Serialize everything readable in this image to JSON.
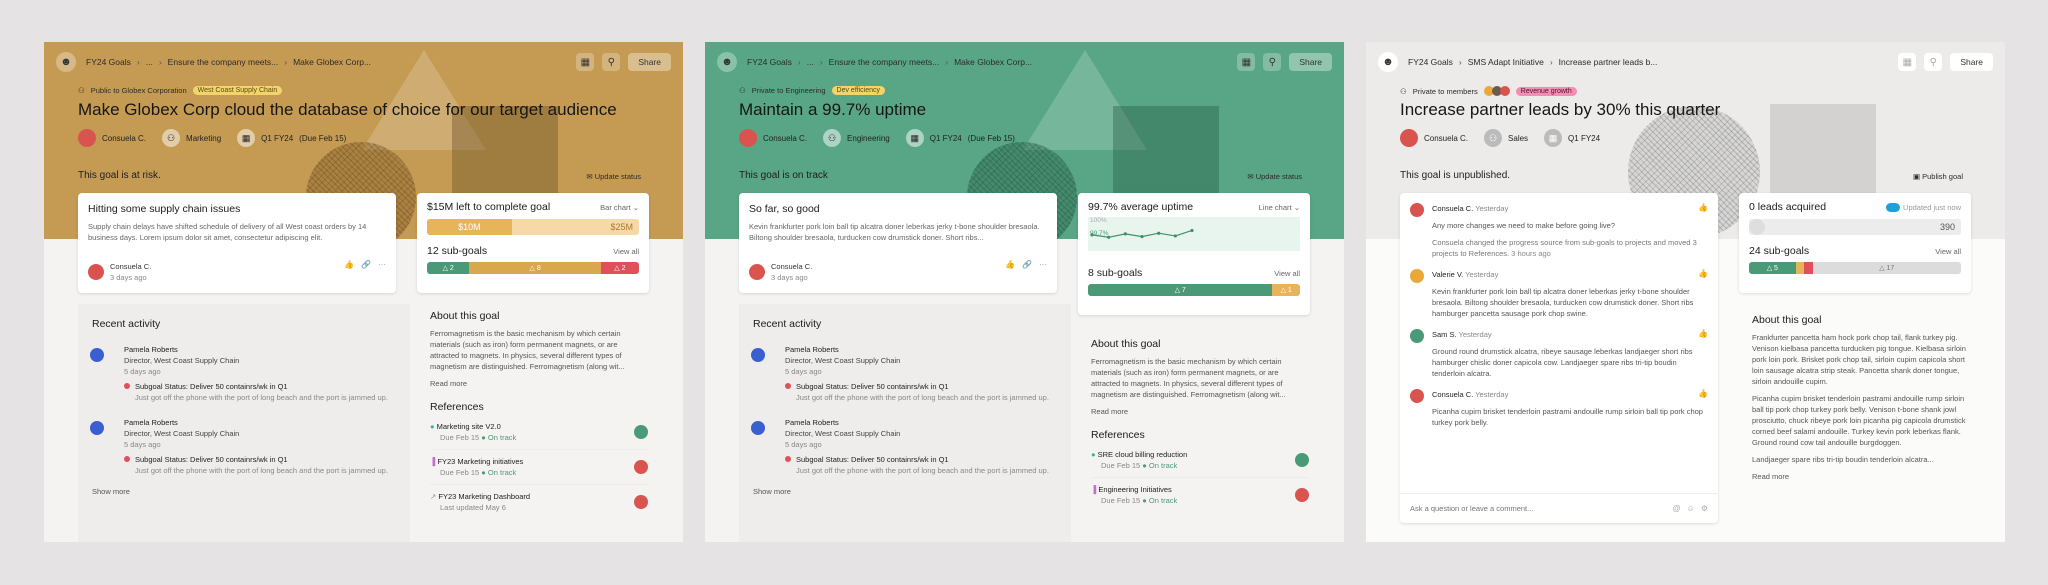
{
  "screens": [
    {
      "theme": {
        "band": "#c59b54",
        "accent": "#c59b54"
      },
      "breadcrumbs": [
        "FY24 Goals",
        "...",
        "Ensure the company meets...",
        "Make Globex Corp..."
      ],
      "share": "Share",
      "privacy": "Public to Globex Corporation",
      "tag": "West Coast Supply Chain",
      "title": "Make Globex Corp cloud the database of choice for our target audience",
      "owner": "Consuela C.",
      "team": "Marketing",
      "period": "Q1 FY24",
      "due": "(Due Feb 15)",
      "status": "This goal is at risk.",
      "update_status": "Update status",
      "update_card": {
        "title": "Hitting some supply chain issues",
        "body": "Supply chain delays have shifted schedule of delivery of all West coast orders by 14 business days. Lorem ipsum dolor sit amet, consectetur adipiscing elit.",
        "author": "Consuela C.",
        "time": "3 days ago"
      },
      "metric_card": {
        "title": "$15M left to complete goal",
        "chart_type": "Bar chart",
        "current": "$10M",
        "target": "$25M",
        "progress": 0.4,
        "subgoals_label": "12 sub-goals",
        "view_all": "View all",
        "seg": [
          {
            "label": "△ 2",
            "share": 0.2,
            "color": "#4a9a78"
          },
          {
            "label": "△ 8",
            "share": 0.62,
            "color": "#d8a74e"
          },
          {
            "label": "△ 2",
            "share": 0.18,
            "color": "#e0505b"
          }
        ]
      },
      "recent_activity": {
        "title": "Recent activity",
        "items": [
          {
            "name": "Pamela Roberts",
            "role": "Director, West Coast Supply Chain",
            "time": "5 days ago",
            "status": "Subgoal Status: Deliver 50 containrs/wk in Q1",
            "note": "Just got off the phone with the port of long beach and the port is jammed up."
          },
          {
            "name": "Pamela Roberts",
            "role": "Director, West Coast Supply Chain",
            "time": "5 days ago",
            "status": "Subgoal Status: Deliver 50 containrs/wk in Q1",
            "note": "Just got off the phone with the port of long beach and the port is jammed up."
          }
        ],
        "show_more": "Show more"
      },
      "about": {
        "title": "About this goal",
        "body": "Ferromagnetism is the basic mechanism by which certain materials (such as iron) form permanent magnets, or are attracted to magnets. In physics, several different types of magnetism are distinguished. Ferromagnetism (along wit...",
        "read_more": "Read more"
      },
      "references": {
        "title": "References",
        "items": [
          {
            "icon": "●",
            "icon_color": "#2bb5a5",
            "name": "Marketing site V2.0",
            "due": "Due Feb 15",
            "state": "On track",
            "av": "#4a9a78"
          },
          {
            "icon": "▐",
            "icon_color": "#c06fd0",
            "name": "FY23 Marketing initiatives",
            "due": "Due Feb 15",
            "state": "On track",
            "av": "#d9534f"
          },
          {
            "icon": "↗",
            "icon_color": "#999",
            "name": "FY23 Marketing Dashboard",
            "due": "Last updated May 6",
            "state": "",
            "av": "#d9534f"
          }
        ]
      }
    },
    {
      "theme": {
        "band": "#58a686",
        "accent": "#58a686"
      },
      "breadcrumbs": [
        "FY24 Goals",
        "...",
        "Ensure the company meets...",
        "Make Globex Corp..."
      ],
      "share": "Share",
      "privacy": "Private to Engineering",
      "tag": "Dev efficiency",
      "title": "Maintain a 99.7% uptime",
      "owner": "Consuela C.",
      "team": "Engineering",
      "period": "Q1 FY24",
      "due": "(Due Feb 15)",
      "status": "This goal is on track",
      "update_status": "Update status",
      "update_card": {
        "title": "So far, so good",
        "body": "Kevin frankfurter pork loin ball tip alcatra doner leberkas jerky t-bone shoulder bresaola. Biltong shoulder bresaola, turducken cow drumstick doner. Short ribs...",
        "author": "Consuela C.",
        "time": "3 days ago"
      },
      "metric_card": {
        "title": "99.7% average uptime",
        "chart_type": "Line chart",
        "y_top": "100%",
        "y_val": "99.7%",
        "line": [
          0.35,
          0.42,
          0.32,
          0.4,
          0.3,
          0.38,
          0.22
        ],
        "subgoals_label": "8 sub-goals",
        "view_all": "View all",
        "seg": [
          {
            "label": "△ 7",
            "share": 0.87,
            "color": "#4a9a78"
          },
          {
            "label": "△ 1",
            "share": 0.13,
            "color": "#e8b45a"
          }
        ]
      },
      "recent_activity": {
        "title": "Recent activity",
        "items": [
          {
            "name": "Pamela Roberts",
            "role": "Director, West Coast Supply Chain",
            "time": "5 days ago",
            "status": "Subgoal Status: Deliver 50 containrs/wk in Q1",
            "note": "Just got off the phone with the port of long beach and the port is jammed up."
          },
          {
            "name": "Pamela Roberts",
            "role": "Director, West Coast Supply Chain",
            "time": "5 days ago",
            "status": "Subgoal Status: Deliver 50 containrs/wk in Q1",
            "note": "Just got off the phone with the port of long beach and the port is jammed up."
          }
        ],
        "show_more": "Show more"
      },
      "about": {
        "title": "About this goal",
        "body": "Ferromagnetism is the basic mechanism by which certain materials (such as iron) form permanent magnets, or are attracted to magnets. In physics, several different types of magnetism are distinguished. Ferromagnetism (along wit...",
        "read_more": "Read more"
      },
      "references": {
        "title": "References",
        "items": [
          {
            "icon": "●",
            "icon_color": "#2bb5a5",
            "name": "SRE cloud billing reduction",
            "due": "Due Feb 15",
            "state": "On track",
            "av": "#4a9a78"
          },
          {
            "icon": "▐",
            "icon_color": "#c06fd0",
            "name": "Engineering Initiatives",
            "due": "Due Feb 15",
            "state": "On track",
            "av": "#d9534f"
          }
        ]
      }
    },
    {
      "theme": {
        "band": "#ecebea",
        "accent": "#aaaaaa"
      },
      "breadcrumbs": [
        "FY24 Goals",
        "SMS Adapt Initiative",
        "Increase partner leads b..."
      ],
      "share": "Share",
      "privacy": "Private to members",
      "tag": "Revenue growth",
      "title": "Increase partner leads by 30% this quarter",
      "owner": "Consuela C.",
      "team": "Sales",
      "period": "Q1 FY24",
      "status": "This goal is unpublished.",
      "publish": "Publish goal",
      "comments": [
        {
          "name": "Consuela C.",
          "time": "Yesterday",
          "body": "Any more changes we need to make before going live?",
          "system": "Consuela changed the progress source from sub-goals to projects and moved 3 projects to References.",
          "system_time": "3 hours ago",
          "av": "#d9534f"
        },
        {
          "name": "Valerie V.",
          "time": "Yesterday",
          "body": "Kevin frankfurter pork loin ball tip alcatra doner leberkas jerky t-bone shoulder bresaola. Biltong shoulder bresaola, turducken cow drumstick doner. Short ribs hamburger pancetta sausage pork chop swine.",
          "av": "#e8a93a"
        },
        {
          "name": "Sam S.",
          "time": "Yesterday",
          "body": "Ground round drumstick alcatra, ribeye sausage leberkas landjaeger short ribs hamburger chislic doner capicola cow. Landjaeger spare ribs tri-tip boudin tenderloin alcatra.",
          "av": "#4a9a78"
        },
        {
          "name": "Consuela C.",
          "time": "Yesterday",
          "body": "Picanha cupim brisket tenderloin pastrami andouille rump sirloin ball tip pork chop turkey pork belly.",
          "av": "#d9534f"
        }
      ],
      "comment_placeholder": "Ask a question or leave a comment...",
      "metric_card": {
        "title": "0 leads acquired",
        "updated": "Updated just now",
        "value": "390",
        "subgoals_label": "24 sub-goals",
        "view_all": "View all",
        "seg": [
          {
            "label": "△ 5",
            "share": 0.22,
            "color": "#4a9a78"
          },
          {
            "label": "",
            "share": 0.04,
            "color": "#e8b45a"
          },
          {
            "label": "",
            "share": 0.04,
            "color": "#e0505b"
          },
          {
            "label": "△ 17",
            "share": 0.7,
            "color": "#dcdcdc"
          }
        ]
      },
      "about": {
        "title": "About this goal",
        "paras": [
          "Frankfurter pancetta ham hock pork chop tail, flank turkey pig. Venison kielbasa pancetta turducken pig tongue. Kielbasa sirloin pork loin pork. Brisket pork chop tail, sirloin cupim capicola short loin sausage alcatra strip steak. Pancetta shank doner tongue, sirloin andouille cupim.",
          "Picanha cupim brisket tenderloin pastrami andouille rump sirloin ball tip pork chop turkey pork belly. Venison t-bone shank jowl prosciutto, chuck ribeye pork loin picanha pig capicola drumstick corned beef salami andouille. Turkey kevin pork leberkas flank. Ground round cow tail andouille burgdoggen.",
          "Landjaeger spare ribs tri-tip boudin tenderloin alcatra..."
        ],
        "read_more": "Read more"
      }
    }
  ]
}
